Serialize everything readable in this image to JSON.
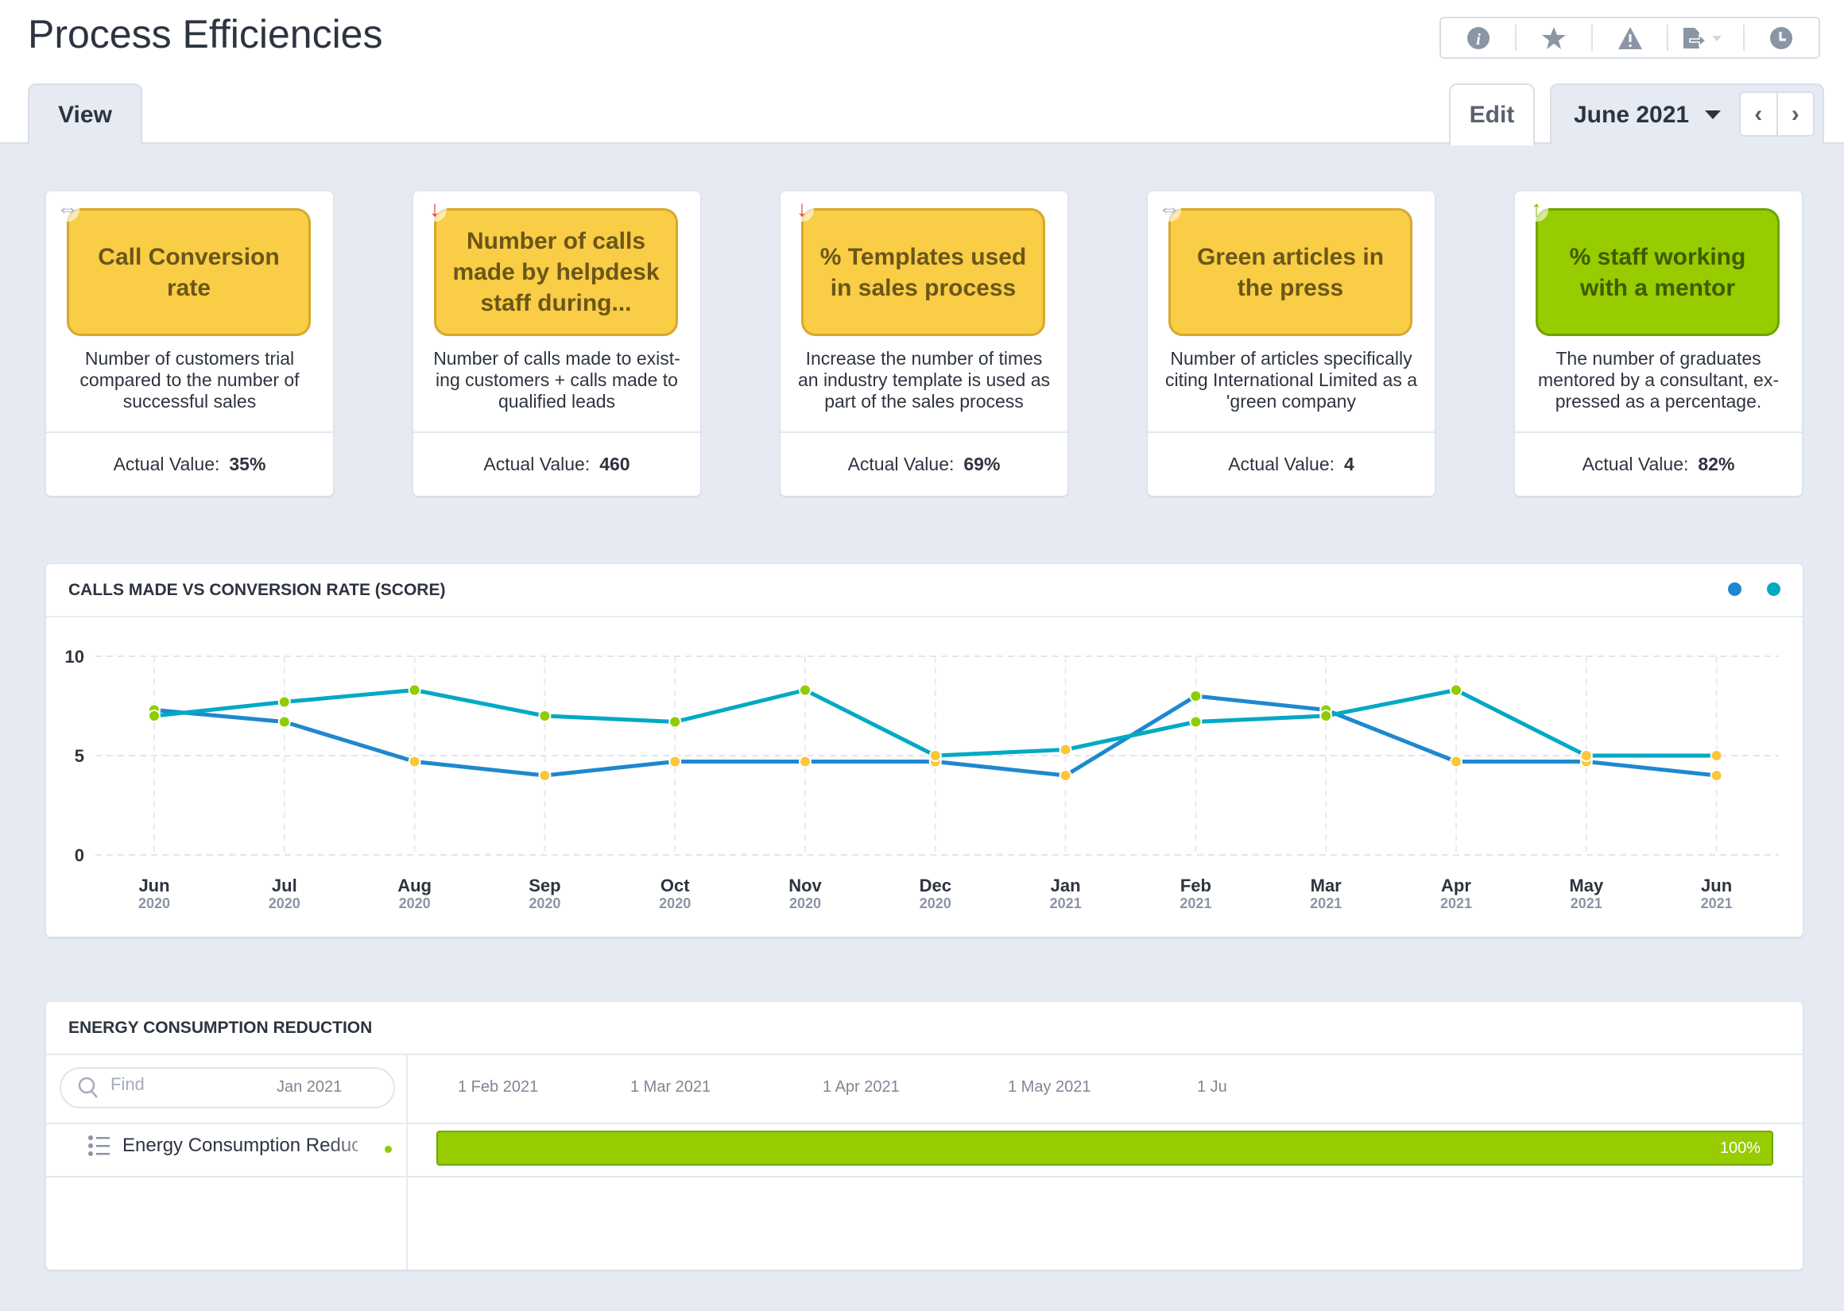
{
  "header": {
    "title": "Process Efficiencies",
    "tabs": {
      "view": "View",
      "edit": "Edit"
    },
    "period": "June 2021",
    "toolbar": [
      "info-icon",
      "star-icon",
      "warning-icon",
      "export-icon",
      "clock-icon"
    ]
  },
  "cards": [
    {
      "title": "Call Conversion rate",
      "trend": "flat",
      "color": "yellow",
      "description": "Number of customers trial compared to the number of successful sales",
      "actual_label": "Actual Value:",
      "actual_value": "35%"
    },
    {
      "title": "Number of calls made by helpdesk staff during...",
      "trend": "down",
      "color": "yellow",
      "description": "Number of calls made to exist-ing customers + calls made to qualified leads",
      "actual_label": "Actual Value:",
      "actual_value": "460"
    },
    {
      "title": "% Templates used in sales process",
      "trend": "down",
      "color": "yellow",
      "description": "Increase the number of times an industry template is used as part of the sales process",
      "actual_label": "Actual Value:",
      "actual_value": "69%"
    },
    {
      "title": "Green articles in the press",
      "trend": "flat",
      "color": "yellow",
      "description": "Number of articles specifically citing International Limited as a 'green company",
      "actual_label": "Actual Value:",
      "actual_value": "4"
    },
    {
      "title": "% staff working with a mentor",
      "trend": "up",
      "color": "green",
      "description": "The number of graduates mentored by a consultant, ex-pressed as a percentage.",
      "actual_label": "Actual Value:",
      "actual_value": "82%"
    }
  ],
  "chart_data": {
    "type": "line",
    "title": "CALLS MADE VS CONVERSION RATE (SCORE)",
    "categories": [
      [
        "Jun",
        "2020"
      ],
      [
        "Jul",
        "2020"
      ],
      [
        "Aug",
        "2020"
      ],
      [
        "Sep",
        "2020"
      ],
      [
        "Oct",
        "2020"
      ],
      [
        "Nov",
        "2020"
      ],
      [
        "Dec",
        "2020"
      ],
      [
        "Jan",
        "2021"
      ],
      [
        "Feb",
        "2021"
      ],
      [
        "Mar",
        "2021"
      ],
      [
        "Apr",
        "2021"
      ],
      [
        "May",
        "2021"
      ],
      [
        "Jun",
        "2021"
      ]
    ],
    "ylim": [
      0,
      10
    ],
    "yticks": [
      0,
      5,
      10
    ],
    "grid": true,
    "legend": "top-right",
    "series": [
      {
        "color": "#1e88cf",
        "values": [
          7.3,
          6.7,
          4.7,
          4.0,
          4.7,
          4.7,
          4.7,
          4.0,
          8.0,
          7.3,
          4.7,
          4.7,
          4.0
        ]
      },
      {
        "color": "#00a9c4",
        "values": [
          7.0,
          7.7,
          8.3,
          7.0,
          6.7,
          8.3,
          5.0,
          5.3,
          6.7,
          7.0,
          8.3,
          5.0,
          5.0
        ]
      }
    ],
    "marker_colors": {
      "good": "#8fcc00",
      "warn": "#fac73a"
    }
  },
  "gantt": {
    "title": "ENERGY CONSUMPTION REDUCTION",
    "search_placeholder": "Find",
    "timeline": [
      "Jan 2021",
      "1 Feb 2021",
      "1 Mar 2021",
      "1 Apr 2021",
      "1 May 2021",
      "1 Ju"
    ],
    "rows": [
      {
        "label": "Energy Consumption Reduction",
        "progress": "100%"
      }
    ]
  }
}
